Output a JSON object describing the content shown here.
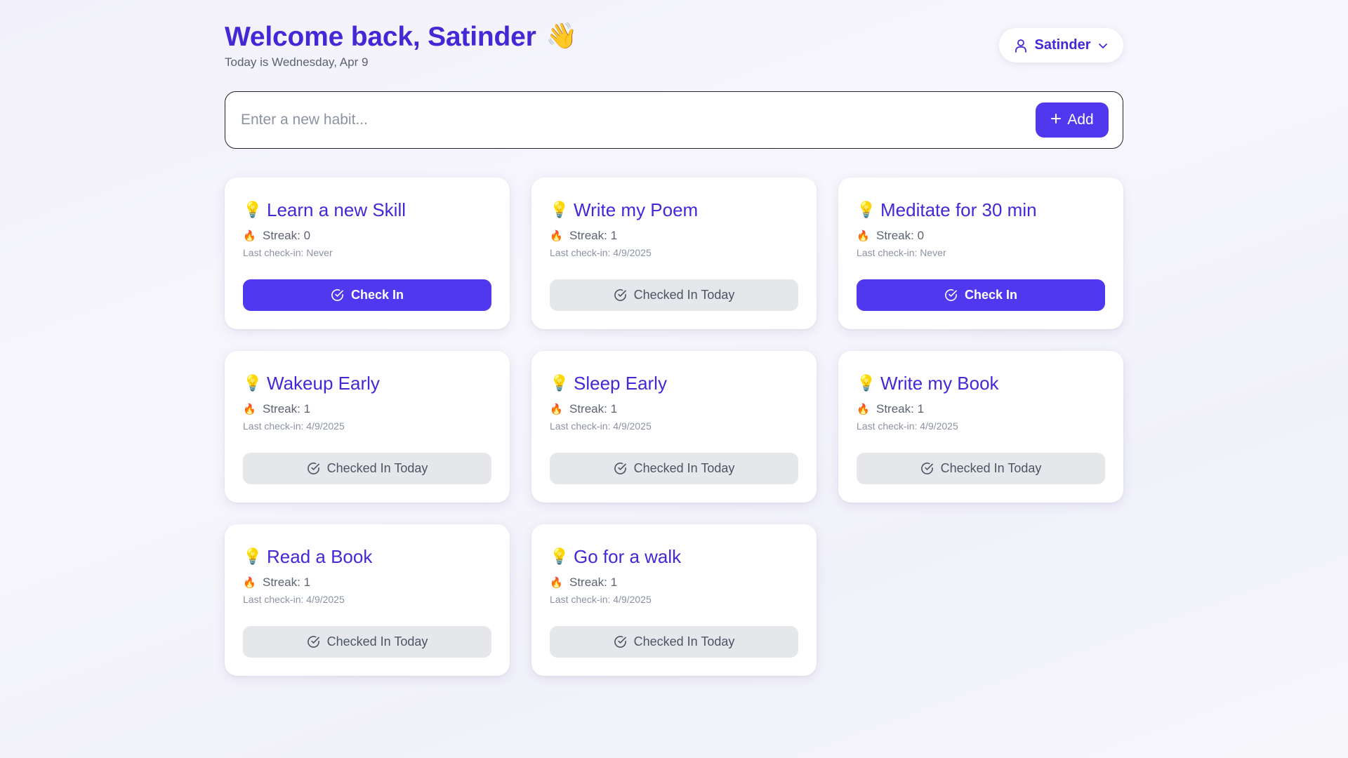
{
  "header": {
    "title": "Welcome back, Satinder",
    "wave_emoji": "👋",
    "subtitle": "Today is Wednesday, Apr 9"
  },
  "user_menu": {
    "name": "Satinder",
    "icon": "user-icon",
    "dropdown_icon": "chevron-down-icon"
  },
  "add_habit": {
    "placeholder": "Enter a new habit...",
    "value": "",
    "button_label": "Add",
    "button_icon": "plus-icon"
  },
  "colors": {
    "accent": "#4f38ee",
    "title": "#4328d6",
    "done_button": "#e5e7eb"
  },
  "habits": [
    {
      "icon": "💡",
      "title": "Learn a new Skill",
      "streak": "Streak: 0",
      "last_checkin": "Last check-in: Never",
      "status": "active",
      "button_label": "Check In"
    },
    {
      "icon": "💡",
      "title": "Write my Poem",
      "streak": "Streak: 1",
      "last_checkin": "Last check-in: 4/9/2025",
      "status": "done",
      "button_label": "Checked In Today"
    },
    {
      "icon": "💡",
      "title": "Meditate for 30 min",
      "streak": "Streak: 0",
      "last_checkin": "Last check-in: Never",
      "status": "active",
      "button_label": "Check In"
    },
    {
      "icon": "💡",
      "title": "Wakeup Early",
      "streak": "Streak: 1",
      "last_checkin": "Last check-in: 4/9/2025",
      "status": "done",
      "button_label": "Checked In Today"
    },
    {
      "icon": "💡",
      "title": "Sleep Early",
      "streak": "Streak: 1",
      "last_checkin": "Last check-in: 4/9/2025",
      "status": "done",
      "button_label": "Checked In Today"
    },
    {
      "icon": "💡",
      "title": "Write my Book",
      "streak": "Streak: 1",
      "last_checkin": "Last check-in: 4/9/2025",
      "status": "done",
      "button_label": "Checked In Today"
    },
    {
      "icon": "💡",
      "title": "Read a Book",
      "streak": "Streak: 1",
      "last_checkin": "Last check-in: 4/9/2025",
      "status": "done",
      "button_label": "Checked In Today"
    },
    {
      "icon": "💡",
      "title": "Go for a walk",
      "streak": "Streak: 1",
      "last_checkin": "Last check-in: 4/9/2025",
      "status": "done",
      "button_label": "Checked In Today"
    }
  ],
  "streak_icon": "🔥"
}
